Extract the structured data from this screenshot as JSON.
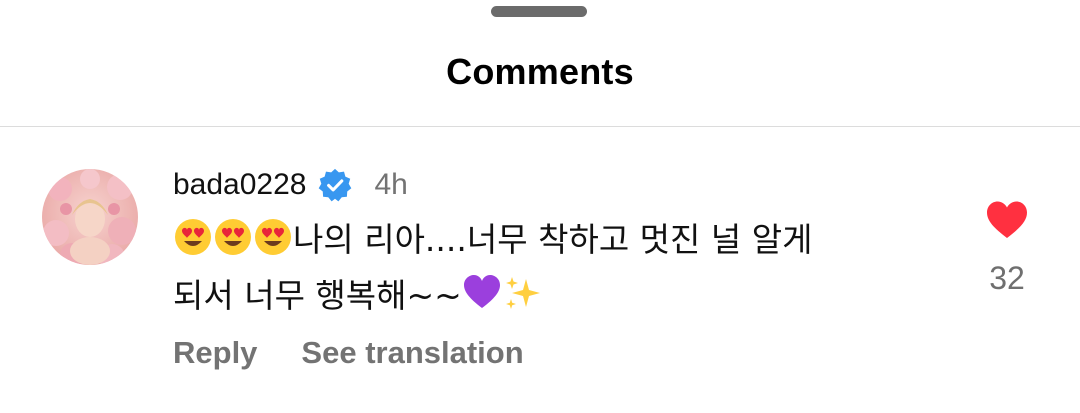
{
  "header": {
    "title": "Comments"
  },
  "comment": {
    "username": "bada0228",
    "verified": true,
    "time": "4h",
    "text_line1": "나의 리아....너무 착하고 멋진 널 알게",
    "text_line2": "되서 너무 행복해~~",
    "emoji_before": [
      "smiling-face-with-heart-eyes-icon",
      "smiling-face-with-heart-eyes-icon",
      "smiling-face-with-heart-eyes-icon"
    ],
    "emoji_after": [
      "purple-heart-icon",
      "sparkles-icon"
    ],
    "reply_label": "Reply",
    "translation_label": "See translation",
    "like_count": "32",
    "liked": true
  },
  "colors": {
    "verified_blue": "#3897f0",
    "like_red": "#ff3040",
    "muted_text": "#737373",
    "divider": "#dcdcdc"
  }
}
